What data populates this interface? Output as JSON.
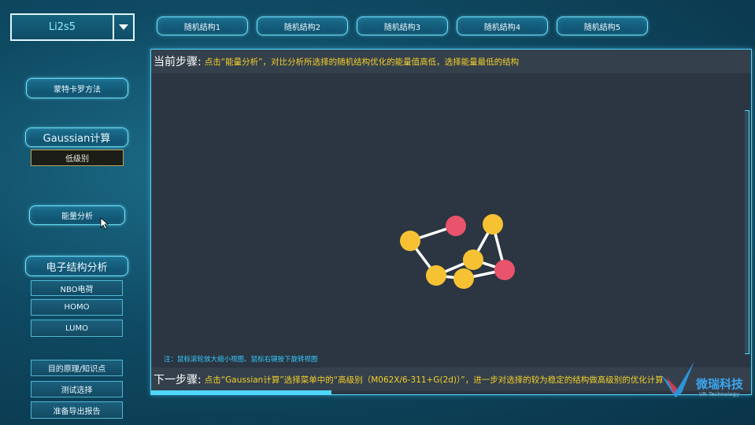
{
  "selector": {
    "value": "Li2s5"
  },
  "top_tabs": [
    "随机结构1",
    "随机结构2",
    "随机结构3",
    "随机结构4",
    "随机结构5"
  ],
  "sidebar": {
    "monte_carlo": "蒙特卡罗方法",
    "gaussian": "Gaussian计算",
    "low_level": "低级别",
    "energy": "能量分析",
    "electronic": "电子结构分析",
    "electronic_items": [
      "NBO电荷",
      "HOMO",
      "LUMO"
    ],
    "bottom_items": [
      "目的原理/知识点",
      "测试选择",
      "准备导出报告"
    ]
  },
  "current_step": {
    "label": "当前步骤:",
    "text": "点击“能量分析”，对比分析所选择的随机结构优化的能量值高低，选择能量最低的结构"
  },
  "note": "注：鼠标滚轮放大缩小视图、鼠标右键按下旋转视图",
  "next_step": {
    "label": "下一步骤:",
    "text": "点击“Gaussian计算”选择菜单中的“高级别（M062X/6-311+G(2d)）”，进一步对选择的较为稳定的结构做高级别的优化计算"
  },
  "logo": {
    "text": "微瑞科技",
    "sub": "VR Technology"
  },
  "colors": {
    "accent": "#6fe4ff",
    "step_text": "#f4cf2a",
    "atom_li": "#f6c234",
    "atom_s": "#e9536b"
  }
}
